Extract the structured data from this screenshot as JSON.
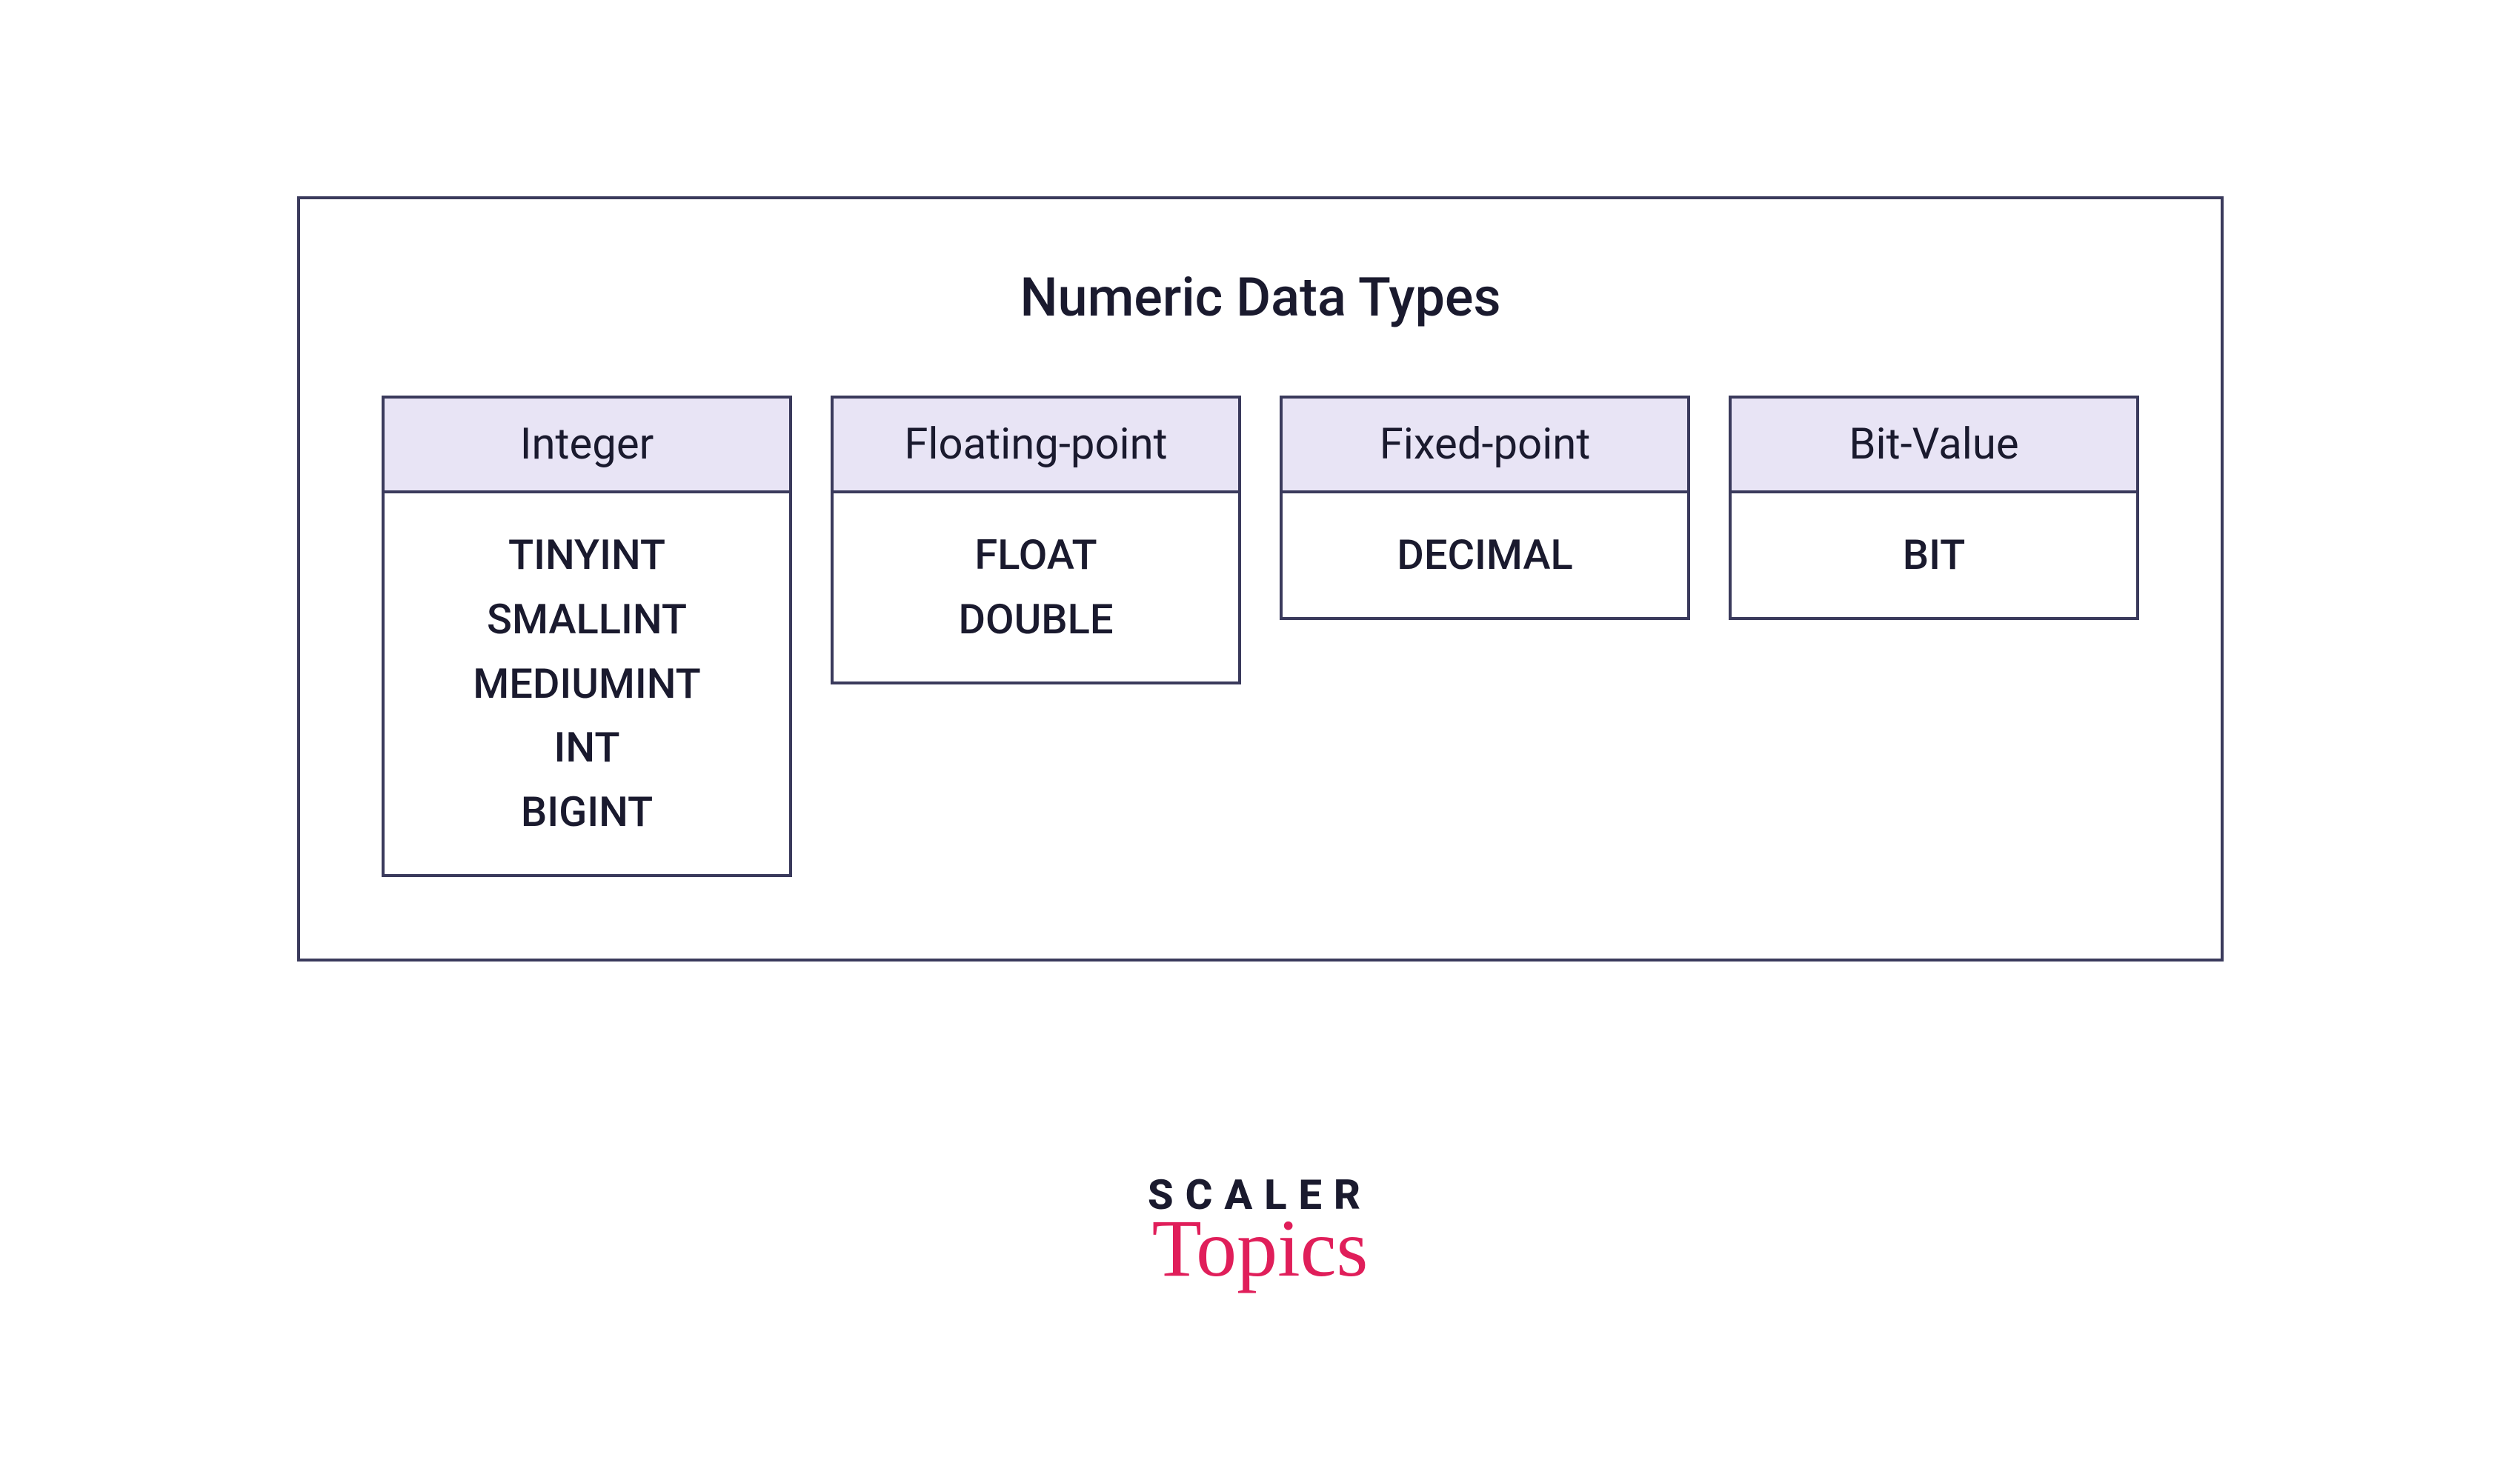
{
  "title": "Numeric Data Types",
  "categories": [
    {
      "name": "Integer",
      "types": [
        "TINYINT",
        "SMALLINT",
        "MEDIUMINT",
        "INT",
        "BIGINT"
      ]
    },
    {
      "name": "Floating-point",
      "types": [
        "FLOAT",
        "DOUBLE"
      ]
    },
    {
      "name": "Fixed-point",
      "types": [
        "DECIMAL"
      ]
    },
    {
      "name": "Bit-Value",
      "types": [
        "BIT"
      ]
    }
  ],
  "logo": {
    "line1": "SCALER",
    "line2": "Topics"
  },
  "colors": {
    "border": "#3a3a5c",
    "header_bg": "#e8e4f5",
    "accent": "#e01e5a"
  }
}
